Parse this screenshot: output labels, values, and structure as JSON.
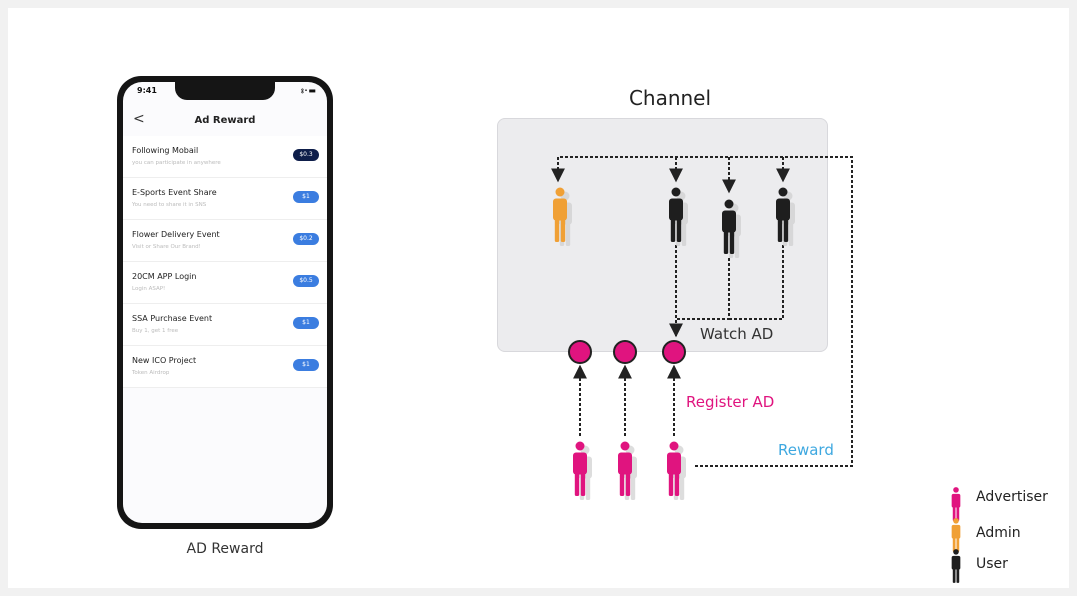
{
  "phone": {
    "status_time": "9:41",
    "status_icons": "⦂‧▬",
    "back_glyph": "<",
    "title": "Ad Reward",
    "items": [
      {
        "name": "Following Mobail",
        "sub": "you can participate in anywhere",
        "value": "$0.3",
        "dark": true
      },
      {
        "name": "E-Sports Event Share",
        "sub": "You need to share it in SNS",
        "value": "$1",
        "dark": false
      },
      {
        "name": "Flower Delivery Event",
        "sub": "Visit or Share Our Brand!",
        "value": "$0.2",
        "dark": false
      },
      {
        "name": "20CM APP Login",
        "sub": "Login ASAP!",
        "value": "$0.5",
        "dark": false
      },
      {
        "name": "SSA Purchase Event",
        "sub": "Buy 1, get 1 free",
        "value": "$1",
        "dark": false
      },
      {
        "name": "New ICO Project",
        "sub": "Token Airdrop",
        "value": "$1",
        "dark": false
      }
    ],
    "caption": "AD Reward"
  },
  "diagram": {
    "channel_title": "Channel",
    "watch_ad": "Watch AD",
    "register_ad": "Register AD",
    "reward": "Reward"
  },
  "legend": [
    {
      "label": "Advertiser",
      "color": "#e0147f"
    },
    {
      "label": "Admin",
      "color": "#f0a035"
    },
    {
      "label": "User",
      "color": "#1e1e1e"
    }
  ],
  "colors": {
    "advertiser": "#e0147f",
    "admin": "#f0a035",
    "user": "#1e1e1e",
    "reward_text": "#3ea8e0",
    "pill_blue": "#3b7de0",
    "pill_dark": "#0e1e4a"
  }
}
